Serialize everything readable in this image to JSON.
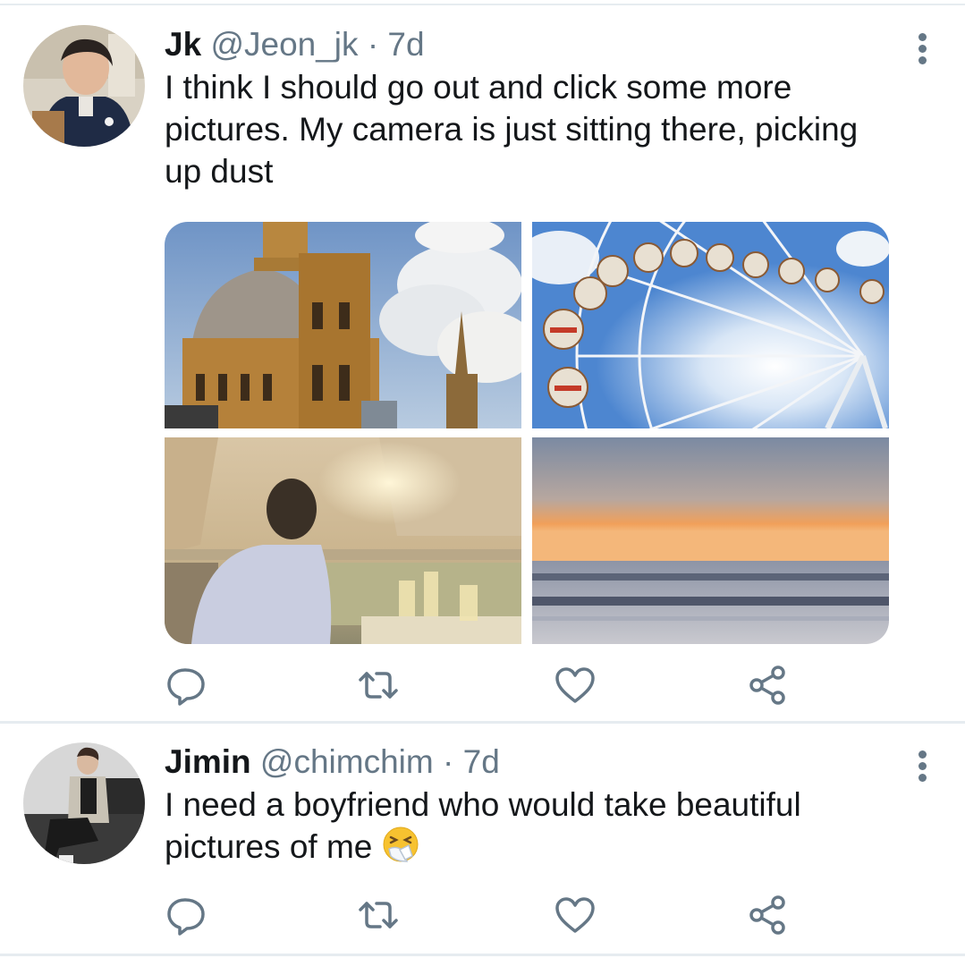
{
  "tweets": [
    {
      "name": "Jk",
      "handle": "@Jeon_jk",
      "separator": "·",
      "time": "7d",
      "text": "I think I should go out and click some more pictures. My camera is just sitting there, picking up dust",
      "photos": [
        "cathedral-dome-photo",
        "ferris-wheel-photo",
        "person-at-sunset-dinner-photo",
        "beach-sunset-photo"
      ]
    },
    {
      "name": "Jimin",
      "handle": "@chimchim",
      "separator": "·",
      "time": "7d",
      "text": "I need a boyfriend who would take beautiful pictures of me",
      "emoji": "sneezing-face-emoji"
    }
  ],
  "icons": {
    "reply": "reply-icon",
    "retweet": "retweet-icon",
    "like": "heart-icon",
    "share": "share-icon",
    "more": "more-vertical-icon"
  },
  "colors": {
    "text": "#14171a",
    "secondary": "#657786",
    "divider": "#e6ecf0"
  }
}
